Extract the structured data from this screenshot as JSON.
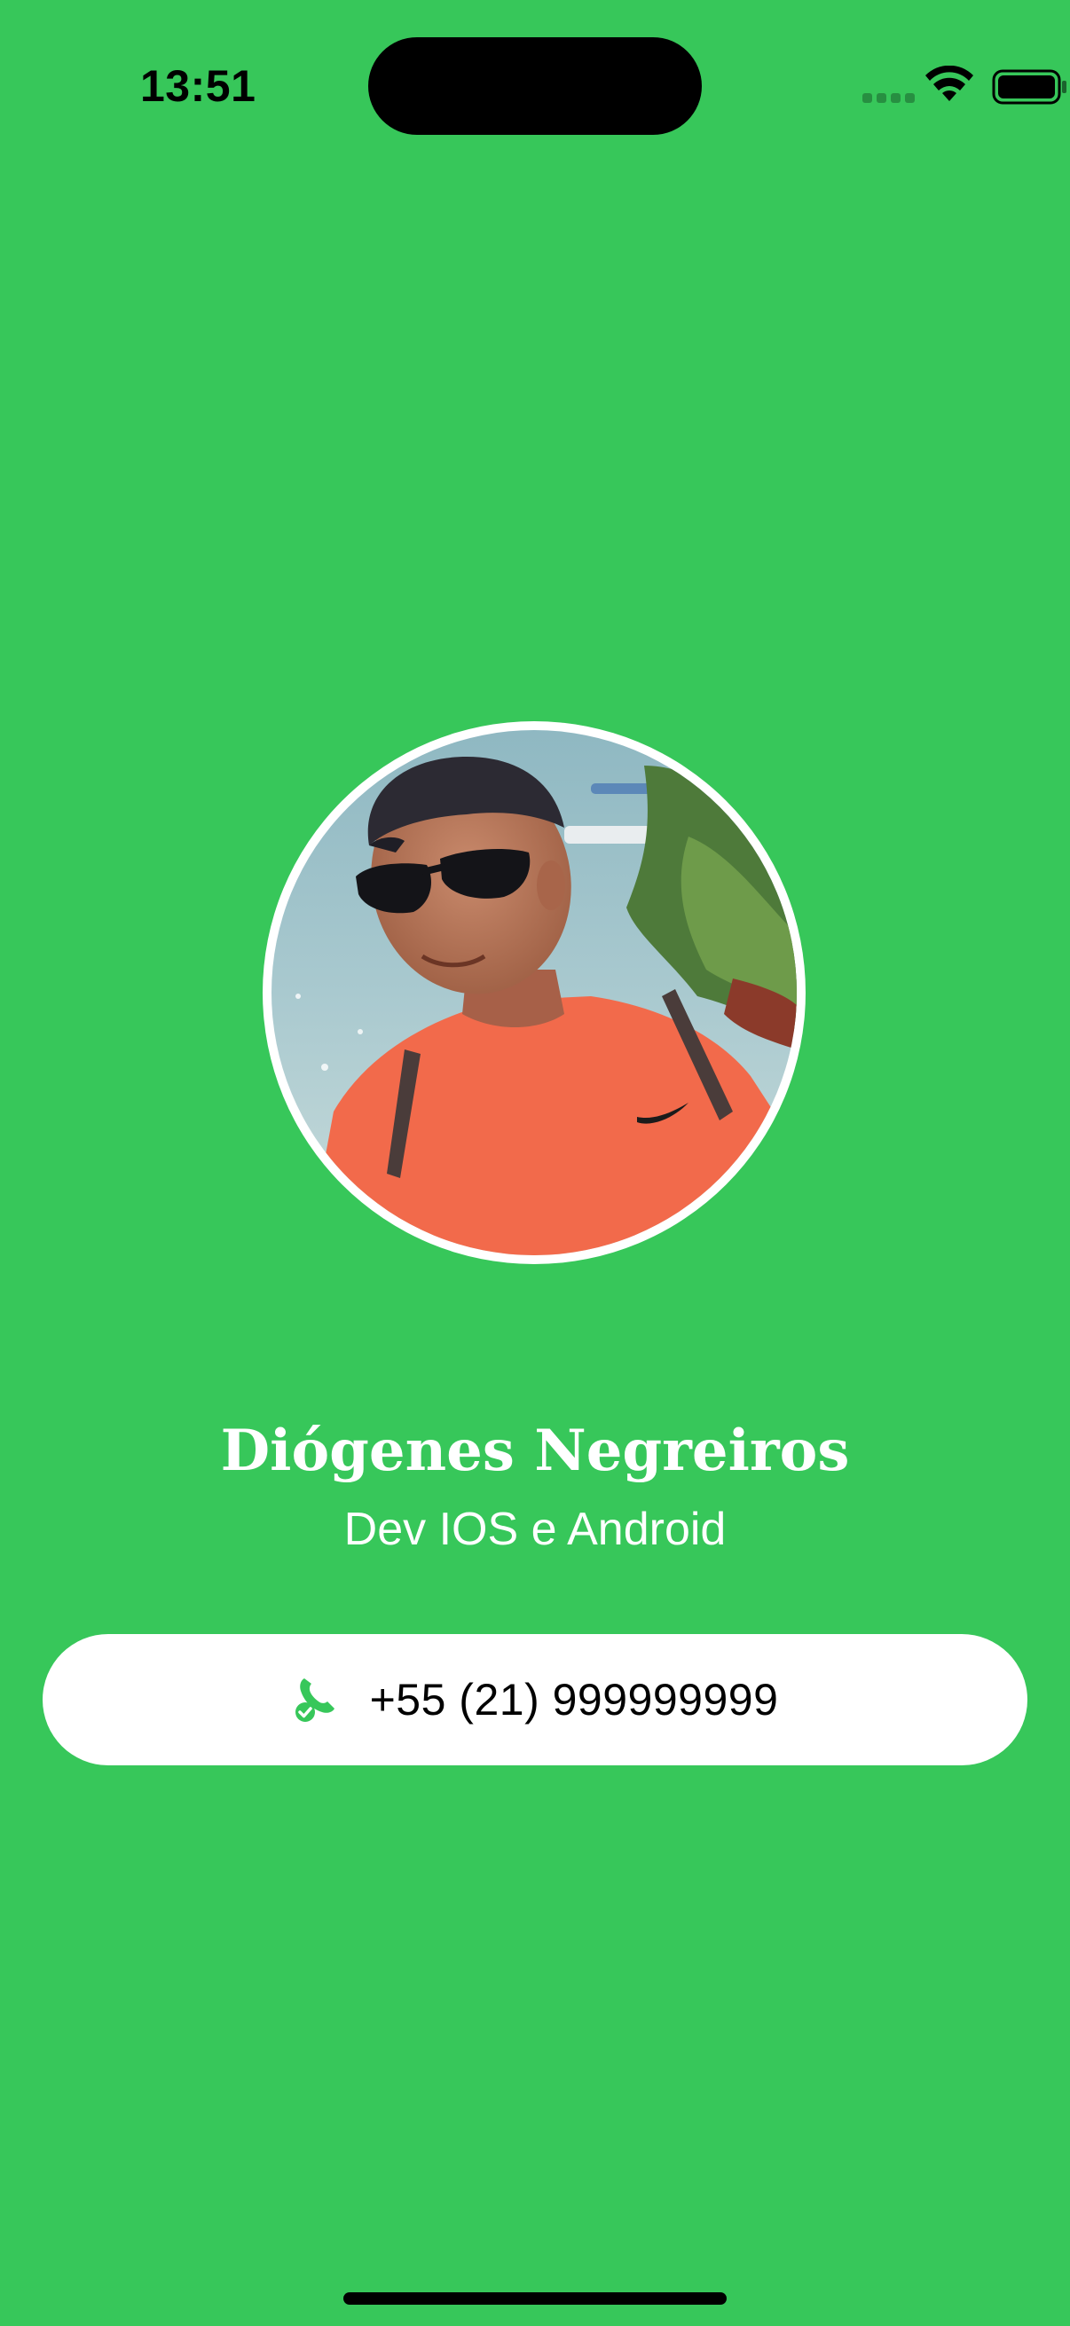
{
  "status_bar": {
    "time": "13:51"
  },
  "profile": {
    "name": "Diógenes Negreiros",
    "role": "Dev IOS e Android",
    "avatar_icon": "profile-photo"
  },
  "contact": {
    "phone": "+55 (21) 999999999",
    "icon": "phone-verified-icon"
  },
  "colors": {
    "background": "#37C75A",
    "pill": "#FFFFFF",
    "accent": "#37C75A"
  }
}
